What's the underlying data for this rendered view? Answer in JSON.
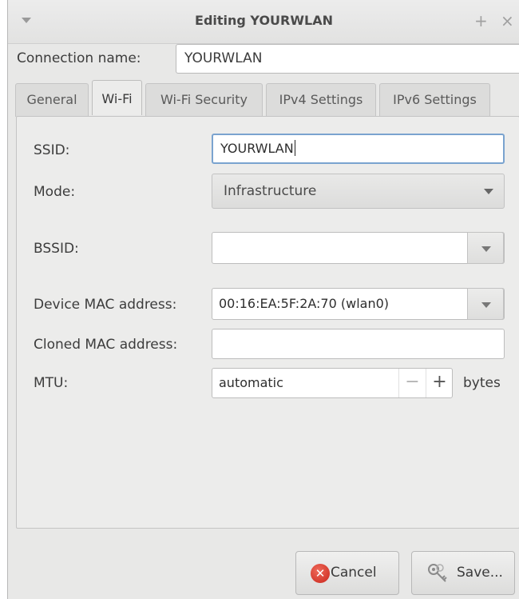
{
  "window": {
    "title": "Editing YOURWLAN",
    "plus_glyph": "+",
    "close_glyph": "×"
  },
  "connection": {
    "label": "Connection name:",
    "value": "YOURWLAN"
  },
  "tabs": [
    {
      "label": "General",
      "active": false
    },
    {
      "label": "Wi-Fi",
      "active": true
    },
    {
      "label": "Wi-Fi Security",
      "active": false
    },
    {
      "label": "IPv4 Settings",
      "active": false
    },
    {
      "label": "IPv6 Settings",
      "active": false
    }
  ],
  "wifi": {
    "ssid_label": "SSID:",
    "ssid_value": "YOURWLAN",
    "mode_label": "Mode:",
    "mode_value": "Infrastructure",
    "bssid_label": "BSSID:",
    "bssid_value": "",
    "device_mac_label": "Device MAC address:",
    "device_mac_value": "00:16:EA:5F:2A:70 (wlan0)",
    "cloned_mac_label": "Cloned MAC address:",
    "cloned_mac_value": "",
    "mtu_label": "MTU:",
    "mtu_value": "automatic",
    "mtu_minus": "−",
    "mtu_plus": "+",
    "mtu_unit": "bytes"
  },
  "buttons": {
    "cancel_label": "Cancel",
    "save_label": "Save..."
  },
  "colors": {
    "focus_border": "#7aa3cf",
    "cancel_icon": "#c9251b"
  }
}
